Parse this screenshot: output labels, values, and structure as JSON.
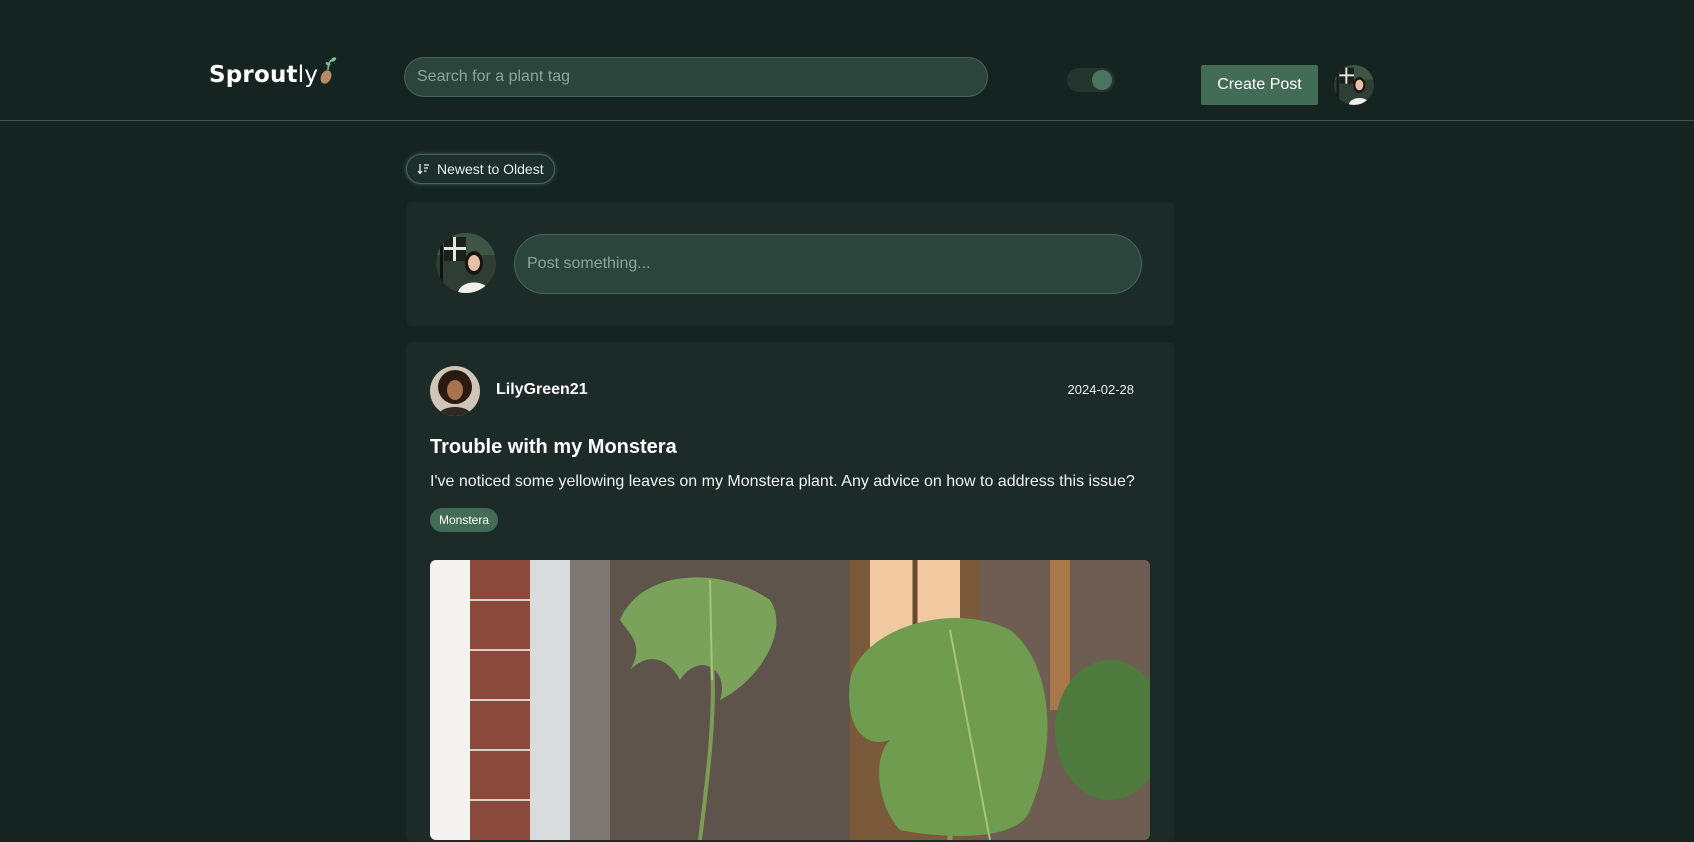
{
  "header": {
    "logo_bold": "Sprout",
    "logo_light": "ly",
    "search_placeholder": "Search for a plant tag",
    "create_post_label": "Create Post"
  },
  "feed": {
    "sort_label": "Newest to Oldest",
    "composer_placeholder": "Post something..."
  },
  "post": {
    "author": "LilyGreen21",
    "date": "2024-02-28",
    "title": "Trouble with my Monstera",
    "body": "I've noticed some yellowing leaves on my Monstera plant. Any advice on how to address this issue?",
    "tag": "Monstera"
  },
  "theme": {
    "background": "#152420",
    "card": "#1c2b27",
    "accent": "#436c57",
    "input_fill": "#2b453d"
  }
}
